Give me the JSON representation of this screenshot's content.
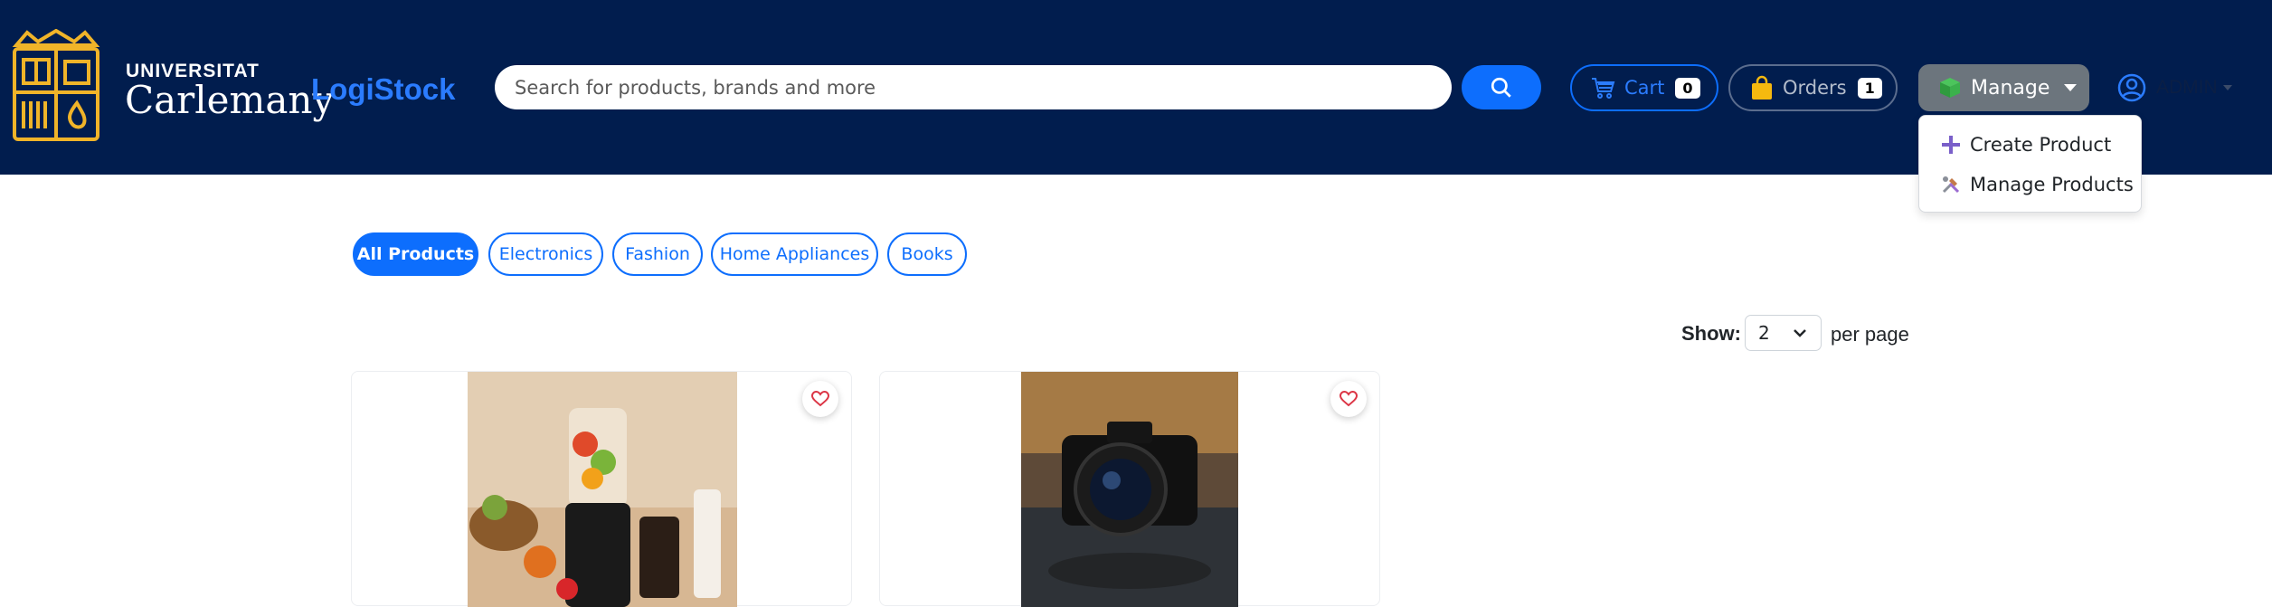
{
  "brand": {
    "university_top": "UNIVERSITAT",
    "university_name": "Carlemany",
    "app_name": "LogiStock"
  },
  "search": {
    "placeholder": "Search for products, brands and more"
  },
  "nav": {
    "cart": {
      "label": "Cart",
      "count": "0"
    },
    "orders": {
      "label": "Orders",
      "count": "1"
    },
    "manage": {
      "label": "Manage"
    },
    "user": {
      "label": "ADMIN"
    }
  },
  "manage_menu": {
    "items": [
      {
        "label": "Create Product"
      },
      {
        "label": "Manage Products"
      }
    ]
  },
  "categories": [
    {
      "label": "All Products",
      "active": true
    },
    {
      "label": "Electronics"
    },
    {
      "label": "Fashion"
    },
    {
      "label": "Home Appliances"
    },
    {
      "label": "Books"
    }
  ],
  "pagination": {
    "show_label": "Show:",
    "per_page_value": "2",
    "per_page_label": "per page"
  },
  "products": [
    {
      "image": "blender-image"
    },
    {
      "image": "camera-image"
    }
  ],
  "colors": {
    "navbar": "#011d4e",
    "primary": "#0d6efd",
    "logo_gold": "#f0b429",
    "manage_btn": "#6c757d"
  }
}
